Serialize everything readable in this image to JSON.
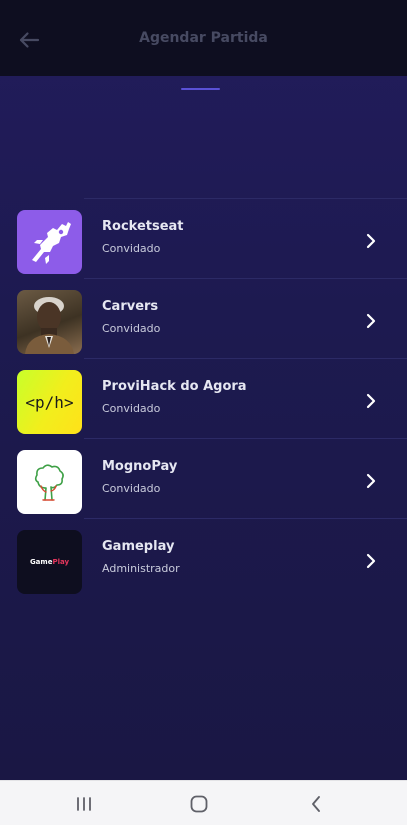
{
  "header": {
    "title": "Agendar Partida",
    "back_icon": "arrow-left-icon"
  },
  "guilds": [
    {
      "name": "Rocketseat",
      "role": "Convidado",
      "avatar": "rocket-logo"
    },
    {
      "name": "Carvers",
      "role": "Convidado",
      "avatar": "portrait-photo"
    },
    {
      "name": "ProviHack do Agora",
      "role": "Convidado",
      "avatar": "provihack-logo",
      "logo_text": "<p/h>"
    },
    {
      "name": "MognoPay",
      "role": "Convidado",
      "avatar": "tree-logo"
    },
    {
      "name": "Gameplay",
      "role": "Administrador",
      "avatar": "gameplay-logo",
      "logo_text": {
        "part1": "Game",
        "part2": "Play"
      }
    }
  ],
  "navbar": {
    "recent_icon": "recent-apps-icon",
    "home_icon": "home-icon",
    "back_icon": "back-chevron-icon"
  },
  "colors": {
    "header_bg": "#0e0e20",
    "background": "#1d1a50",
    "accent": "#5a51d6",
    "rocketseat": "#8d5ce9",
    "text_heading": "#e6e7f2",
    "text_title_muted": "#474a62"
  }
}
